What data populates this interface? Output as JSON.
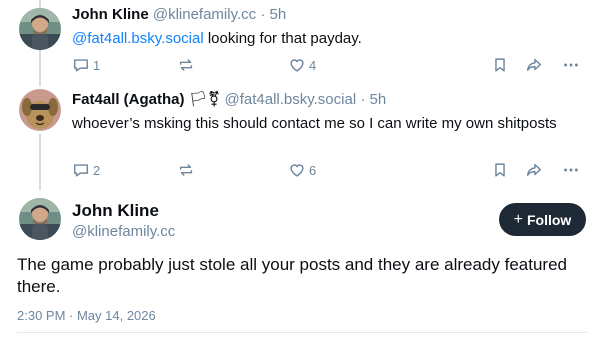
{
  "post1": {
    "author_name": "John Kline",
    "author_handle": "@klinefamily.cc",
    "separator": "·",
    "time": "5h",
    "mention": "@fat4all.bsky.social",
    "text": " looking for that payday.",
    "reply_count": "1",
    "like_count": "4"
  },
  "post2": {
    "author_name": "Fat4all (Agatha)",
    "author_flags": "🏳⚧",
    "author_handle": "@fat4all.bsky.social",
    "separator": "·",
    "time": "5h",
    "text": "whoever’s msking this should contact me so I can write my own shitposts",
    "reply_count": "2",
    "like_count": "6"
  },
  "main_post": {
    "author_name": "John Kline",
    "author_handle": "@klinefamily.cc",
    "follow_label": "Follow",
    "follow_icon": "+",
    "text": "The game probably just stole all your posts and they are already featured there.",
    "timestamp": "2:30 PM · May 14, 2026"
  },
  "icons": [
    "reply-icon",
    "repost-icon",
    "like-icon",
    "bookmark-icon",
    "share-icon",
    "more-icon"
  ],
  "colors": {
    "accent": "#1083fe",
    "muted": "#6f869f",
    "button_bg": "#1e2936",
    "thread_line": "#d4dbe2"
  }
}
